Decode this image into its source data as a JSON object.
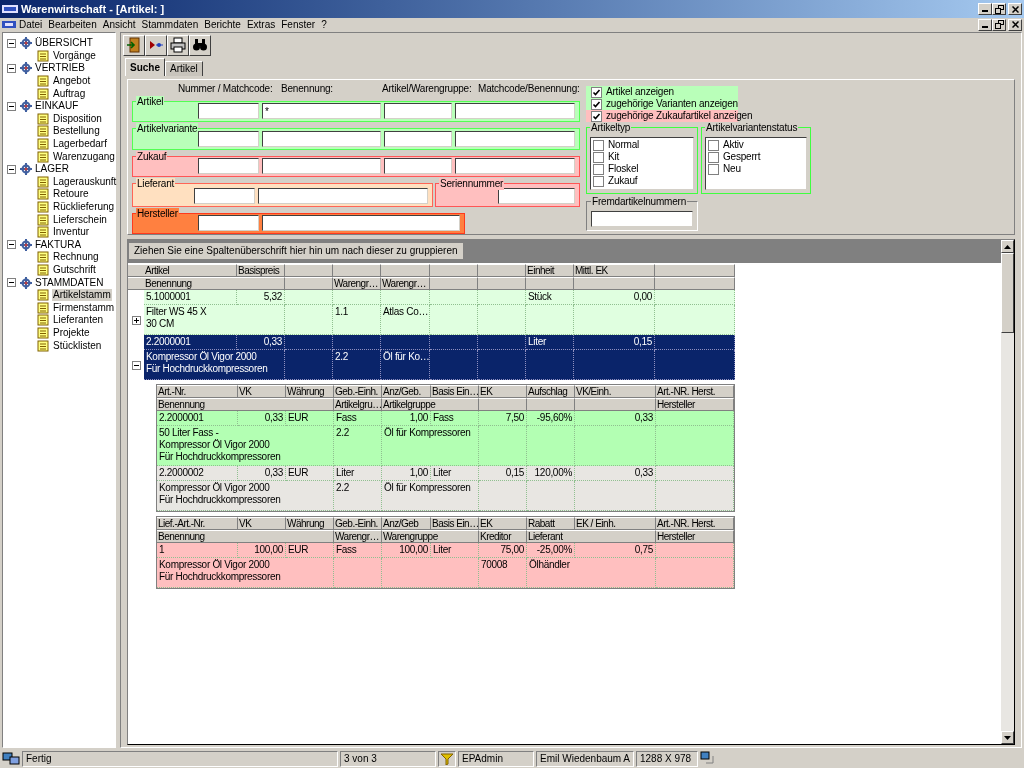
{
  "window": {
    "title": "Warenwirtschaft - [Artikel: ]"
  },
  "menu": [
    "Datei",
    "Bearbeiten",
    "Ansicht",
    "Stammdaten",
    "Berichte",
    "Extras",
    "Fenster",
    "?"
  ],
  "sidebar": {
    "sections": [
      {
        "label": "ÜBERSICHT",
        "expanded": true,
        "children": [
          {
            "label": "Vorgänge",
            "selected": false
          }
        ]
      },
      {
        "label": "VERTRIEB",
        "expanded": true,
        "children": [
          {
            "label": "Angebot",
            "selected": false
          },
          {
            "label": "Auftrag",
            "selected": false
          }
        ]
      },
      {
        "label": "EINKAUF",
        "expanded": true,
        "children": [
          {
            "label": "Disposition",
            "selected": false
          },
          {
            "label": "Bestellung",
            "selected": false
          },
          {
            "label": "Lagerbedarf",
            "selected": false
          },
          {
            "label": "Warenzugang",
            "selected": false
          }
        ]
      },
      {
        "label": "LAGER",
        "expanded": true,
        "children": [
          {
            "label": "Lagerauskunft",
            "selected": false
          },
          {
            "label": "Retoure",
            "selected": false
          },
          {
            "label": "Rücklieferung",
            "selected": false
          },
          {
            "label": "Lieferschein",
            "selected": false
          },
          {
            "label": "Inventur",
            "selected": false
          }
        ]
      },
      {
        "label": "FAKTURA",
        "expanded": true,
        "children": [
          {
            "label": "Rechnung",
            "selected": false
          },
          {
            "label": "Gutschrift",
            "selected": false
          }
        ]
      },
      {
        "label": "STAMMDATEN",
        "expanded": true,
        "children": [
          {
            "label": "Artikelstamm",
            "selected": true
          },
          {
            "label": "Firmenstamm",
            "selected": false
          },
          {
            "label": "Lieferanten",
            "selected": false
          },
          {
            "label": "Projekte",
            "selected": false
          },
          {
            "label": "Stücklisten",
            "selected": false
          }
        ]
      }
    ]
  },
  "tabs": [
    {
      "label": "Suche",
      "selected": true
    },
    {
      "label": "Artikel",
      "selected": false
    }
  ],
  "search_form": {
    "column_labels": [
      "Nummer / Matchcode:",
      "Benennung:",
      "Artikel/Warengruppe:",
      "Matchcode/Benennung:"
    ],
    "groups": [
      {
        "label": "Artikel",
        "kind": "full",
        "color": "#b9ffb9",
        "benennung": "*"
      },
      {
        "label": "Artikelvariante",
        "kind": "full",
        "color": "#b9ffb9"
      },
      {
        "label": "Zukauf",
        "kind": "full",
        "color": "#ffbfbf"
      },
      {
        "label": "Lieferant",
        "kind": "pair",
        "color": "#ffe0c0"
      },
      {
        "label": "Seriennummer",
        "kind": "single",
        "color": "#ffbfbf"
      },
      {
        "label": "Hersteller",
        "kind": "pair",
        "color": "#ff8040"
      }
    ]
  },
  "display_options": [
    {
      "label": "Artikel anzeigen",
      "checked": true,
      "color": "#b9ffb9"
    },
    {
      "label": "zugehörige Varianten anzeigen",
      "checked": true,
      "color": "#b9ffb9"
    },
    {
      "label": "zugehörige Zukaufartikel anzeigen",
      "checked": true,
      "color": "#ffbfbf"
    }
  ],
  "artikeltyp": {
    "title": "Artikeltyp",
    "options": [
      {
        "label": "Normal",
        "checked": false
      },
      {
        "label": "Kit",
        "checked": false
      },
      {
        "label": "Floskel",
        "checked": false
      },
      {
        "label": "Zukauf",
        "checked": false
      }
    ]
  },
  "artikelvariantenstatus": {
    "title": "Artikelvariantenstatus",
    "options": [
      {
        "label": "Aktiv",
        "checked": false
      },
      {
        "label": "Gesperrt",
        "checked": false
      },
      {
        "label": "Neu",
        "checked": false
      }
    ]
  },
  "fremdartikelnummern": {
    "title": "Fremdartikelnummern"
  },
  "group_by_hint": "Ziehen Sie eine Spaltenüberschrift hier hin um nach dieser zu gruppieren",
  "grid": {
    "kind": "articles",
    "columns": {
      "artikel": "Artikel",
      "basispreis": "Basispreis",
      "einheit": "Einheit",
      "mittl_ek": "Mittl. EK",
      "benennung": "Benennung",
      "warengruppe": "Warengr…",
      "warengruppe_name": "Warengr…"
    },
    "records": [
      {
        "selected": false,
        "expanded": false,
        "artikel": "5.1000001",
        "basispreis": "5,32",
        "einheit": "Stück",
        "mittl_ek": "0,00",
        "benennung": "Filter WS 45 X\n30 CM",
        "warengruppe": "1.1",
        "warengruppe_name": "Atlas Co…"
      },
      {
        "selected": true,
        "expanded": true,
        "artikel": "2.2000001",
        "basispreis": "0,33",
        "einheit": "Liter",
        "mittl_ek": "0,15",
        "benennung": "Kompressor Öl Vigor 2000\nFür Hochdruckkompressoren",
        "warengruppe": "2.2",
        "warengruppe_name": "Öl für Ko…",
        "detail_grids": [
          {
            "kind": "variants",
            "columns": {
              "art_nr": "Art.-Nr.",
              "vk": "VK",
              "waehrung": "Währung",
              "geb_einh": "Geb.-Einh.",
              "anz_geb": "Anz/Geb.",
              "basis_einh": "Basis Ein…",
              "ek": "EK",
              "aufschlag": "Aufschlag",
              "vk_einh": "VK/Einh.",
              "art_nr_herst": "Art.-NR. Herst.",
              "benennung": "Benennung",
              "artikelgruppe": "Artikelgru…",
              "artikelgruppe_name": "Artikelgruppe",
              "hersteller": "Hersteller"
            },
            "records": [
              {
                "color": "#b3ffb3",
                "art_nr": "2.2000001",
                "vk": "0,33",
                "waehrung": "EUR",
                "geb_einh": "Fass",
                "anz_geb": "1,00",
                "basis_einh": "Fass",
                "ek": "7,50",
                "aufschlag": "-95,60%",
                "vk_einh": "0,33",
                "benennung": "50 Liter Fass -\nKompressor Öl Vigor 2000\nFür Hochdruckkompressoren",
                "artikelgruppe": "2.2",
                "artikelgruppe_name": "Öl für Kompressoren"
              },
              {
                "color": "#e8e6e2",
                "art_nr": "2.2000002",
                "vk": "0,33",
                "waehrung": "EUR",
                "geb_einh": "Liter",
                "anz_geb": "1,00",
                "basis_einh": "Liter",
                "ek": "0,15",
                "aufschlag": "120,00%",
                "vk_einh": "0,33",
                "benennung": "Kompressor Öl Vigor 2000\nFür Hochdruckkompressoren",
                "artikelgruppe": "2.2",
                "artikelgruppe_name": "Öl für Kompressoren"
              }
            ]
          },
          {
            "kind": "purchases",
            "columns": {
              "lief_art_nr": "Lief.-Art.-Nr.",
              "vk": "VK",
              "waehrung": "Währung",
              "geb_einh": "Geb.-Einh.",
              "anz_geb": "Anz/Geb",
              "basis_einh": "Basis Ein…",
              "ek": "EK",
              "rabatt": "Rabatt",
              "ek_einh": "EK / Einh.",
              "art_nr_herst": "Art.-NR. Herst.",
              "benennung": "Benennung",
              "warengruppe": "Warengr…",
              "warengruppe_name": "Warengruppe",
              "kreditor": "Kreditor",
              "lieferant": "Lieferant",
              "hersteller": "Hersteller"
            },
            "records": [
              {
                "color": "#ffbfbf",
                "lief_art_nr": "1",
                "vk": "100,00",
                "waehrung": "EUR",
                "geb_einh": "Fass",
                "anz_geb": "100,00",
                "basis_einh": "Liter",
                "ek": "75,00",
                "rabatt": "-25,00%",
                "ek_einh": "0,75",
                "benennung": "Kompressor Öl Vigor 2000\nFür Hochdruckkompressoren",
                "kreditor": "70008",
                "lieferant": "Ölhändler"
              }
            ]
          }
        ]
      }
    ]
  },
  "status_bar": {
    "message": "Fertig",
    "record": "3 von 3",
    "user": "EPAdmin",
    "name": "Emil Wiedenbaum A",
    "resolution": "1288 X 978"
  }
}
